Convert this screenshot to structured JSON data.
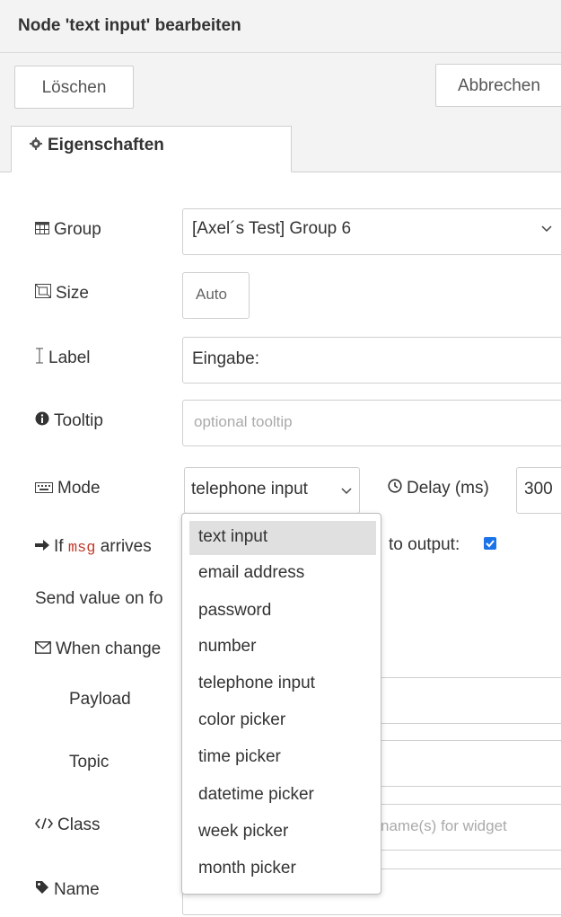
{
  "header": {
    "title": "Node 'text input' bearbeiten"
  },
  "toolbar": {
    "delete_label": "Löschen",
    "cancel_label": "Abbrechen"
  },
  "tabs": [
    {
      "label": "Eigenschaften",
      "icon": "gear-icon"
    }
  ],
  "form": {
    "group": {
      "label": "Group",
      "icon": "table-icon",
      "value": "[Axel´s Test] Group 6"
    },
    "size": {
      "label": "Size",
      "icon": "resize-icon",
      "value": "Auto"
    },
    "label": {
      "label": "Label",
      "icon": "text-cursor-icon",
      "value": "Eingabe:"
    },
    "tooltip": {
      "label": "Tooltip",
      "icon": "info-icon",
      "placeholder": "optional tooltip"
    },
    "mode": {
      "label": "Mode",
      "icon": "keyboard-icon",
      "value": "telephone input"
    },
    "delay": {
      "label": "Delay (ms)",
      "icon": "clock-icon",
      "value": "300"
    },
    "passthru": {
      "prefix": "If",
      "code": "msg",
      "suffix": "arrives",
      "output_label": "to output:",
      "checked": true
    },
    "focus": {
      "label": "Send value on fo"
    },
    "when_changed": {
      "label": "When change",
      "icon": "envelope-icon"
    },
    "payload": {
      "label": "Payload"
    },
    "topic": {
      "label": "Topic"
    },
    "class": {
      "label": "Class",
      "icon": "code-icon",
      "placeholder": "name(s) for widget"
    },
    "name": {
      "label": "Name",
      "icon": "tag-icon"
    }
  },
  "mode_dropdown": {
    "selected": "text input",
    "options": [
      "text input",
      "email address",
      "password",
      "number",
      "telephone input",
      "color picker",
      "time picker",
      "datetime picker",
      "week picker",
      "month picker"
    ]
  },
  "colors": {
    "accent": "#1a73e8",
    "header_bg": "#f3f3f3",
    "code": "#c0392b"
  }
}
